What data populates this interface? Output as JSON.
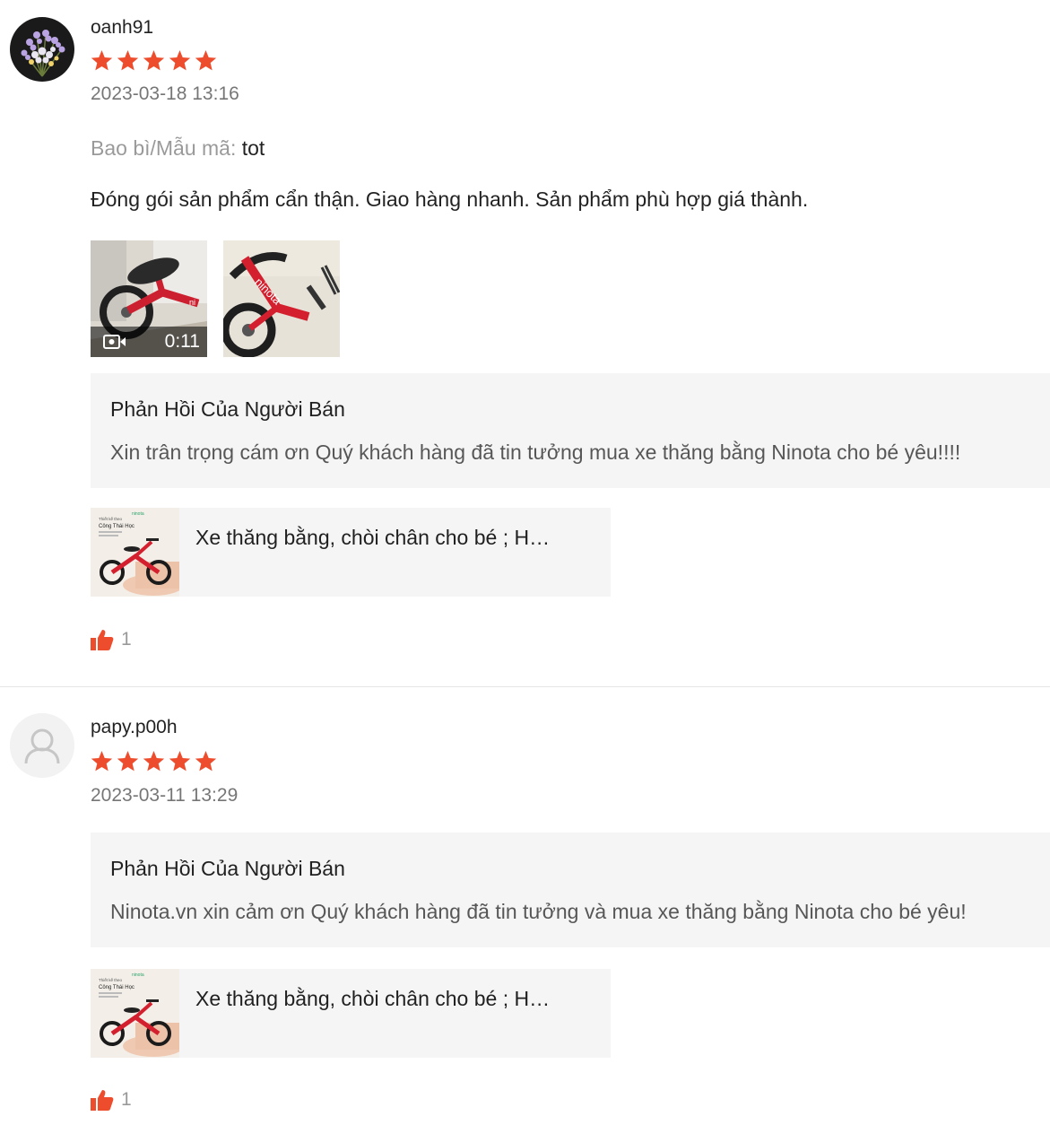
{
  "colors": {
    "star": "#ee4d2d",
    "like": "#ee4d2d",
    "reply_bg": "#f5f5f5"
  },
  "reviews": [
    {
      "username": "oanh91",
      "avatar_icon": "avatar-flowers",
      "rating": 5,
      "date": "2023-03-18 13:16",
      "attribute": {
        "label": "Bao bì/Mẫu mã:",
        "value": "tot"
      },
      "comment": "Đóng gói sản phẩm cẩn thận. Giao hàng nhanh. Sản phẩm phù hợp giá thành.",
      "media": {
        "video_duration": "0:11",
        "video_icon": "video-camera-icon"
      },
      "seller_reply": {
        "title": "Phản Hồi Của Người Bán",
        "text": "Xin trân trọng cám ơn Quý khách hàng đã tin tưởng mua xe thăng bằng Ninota cho bé yêu!!!!"
      },
      "product": {
        "name": "Xe thăng bằng, chòi chân cho bé ; H…",
        "brand": "ninota",
        "banner_line1": "Thiết kế theo",
        "banner_line2": "Công Thái Học"
      },
      "likes": "1"
    },
    {
      "username": "papy.p00h",
      "avatar_icon": "default-user-icon",
      "rating": 5,
      "date": "2023-03-11 13:29",
      "seller_reply": {
        "title": "Phản Hồi Của Người Bán",
        "text": "Ninota.vn xin cảm ơn Quý khách hàng đã tin tưởng và mua xe thăng bằng Ninota cho bé yêu!"
      },
      "product": {
        "name": "Xe thăng bằng, chòi chân cho bé ; H…",
        "brand": "ninota",
        "banner_line1": "Thiết kế theo",
        "banner_line2": "Công Thái Học"
      },
      "likes": "1"
    }
  ]
}
